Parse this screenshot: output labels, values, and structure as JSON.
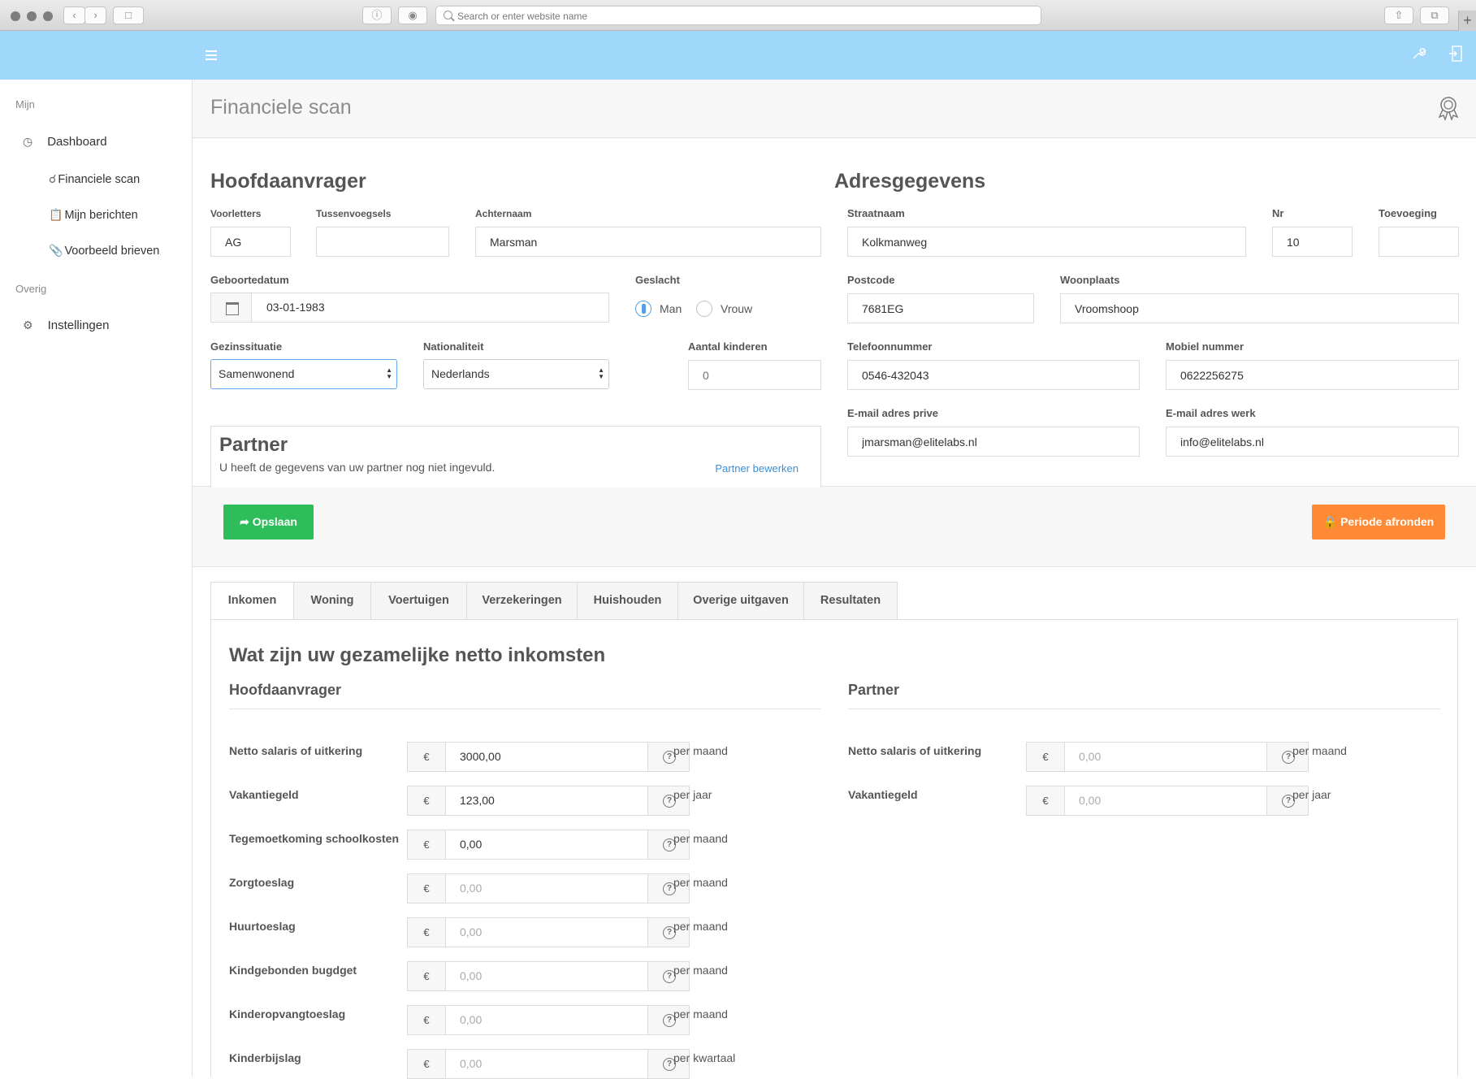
{
  "browser": {
    "url_placeholder": "Search or enter website name",
    "add_tab": "+"
  },
  "sidebar": {
    "section_mijn": "Mijn",
    "dashboard": "Dashboard",
    "financiele_scan": "Financiele scan",
    "mijn_berichten": "Mijn berichten",
    "voorbeeld_brieven": "Voorbeeld brieven",
    "section_overig": "Overig",
    "instellingen": "Instellingen"
  },
  "page": {
    "title": "Financiele scan"
  },
  "hoofdaanvrager": {
    "title": "Hoofdaanvrager",
    "voorletters_label": "Voorletters",
    "voorletters": "AG",
    "tussenvoegsels_label": "Tussenvoegsels",
    "tussenvoegsels": "",
    "achternaam_label": "Achternaam",
    "achternaam": "Marsman",
    "geboortedatum_label": "Geboortedatum",
    "geboortedatum": "03-01-1983",
    "geslacht_label": "Geslacht",
    "geslacht_man": "Man",
    "geslacht_vrouw": "Vrouw",
    "gezinssituatie_label": "Gezinssituatie",
    "gezinssituatie": "Samenwonend",
    "nationaliteit_label": "Nationaliteit",
    "nationaliteit": "Nederlands",
    "kinderen_label": "Aantal kinderen",
    "kinderen_placeholder": "0"
  },
  "partner": {
    "title": "Partner",
    "description": "U heeft de gegevens van uw partner nog niet ingevuld.",
    "link": "Partner bewerken"
  },
  "adres": {
    "title": "Adresgegevens",
    "straatnaam_label": "Straatnaam",
    "straatnaam": "Kolkmanweg",
    "nr_label": "Nr",
    "nr": "10",
    "toevoeging_label": "Toevoeging",
    "toevoeging": "",
    "postcode_label": "Postcode",
    "postcode": "7681EG",
    "woonplaats_label": "Woonplaats",
    "woonplaats": "Vroomshoop",
    "telefoon_label": "Telefoonnummer",
    "telefoon": "0546-432043",
    "mobiel_label": "Mobiel nummer",
    "mobiel": "0622256275",
    "email_prive_label": "E-mail adres prive",
    "email_prive": "jmarsman@elitelabs.nl",
    "email_werk_label": "E-mail adres werk",
    "email_werk": "info@elitelabs.nl"
  },
  "actions": {
    "save": "Opslaan",
    "close_period": "Periode afronden"
  },
  "tabs": [
    "Inkomen",
    "Woning",
    "Voertuigen",
    "Verzekeringen",
    "Huishouden",
    "Overige uitgaven",
    "Resultaten"
  ],
  "inkomen": {
    "question": "Wat zijn uw gezamelijke netto inkomsten",
    "currency": "€",
    "main_title": "Hoofdaanvrager",
    "partner_title": "Partner",
    "main_rows": [
      {
        "label": "Netto salaris of uitkering",
        "value": "3000,00",
        "unit": "per maand"
      },
      {
        "label": "Vakantiegeld",
        "value": "123,00",
        "unit": "per jaar"
      },
      {
        "label": "Tegemoetkoming schoolkosten",
        "value": "0,00",
        "unit": "per maand"
      },
      {
        "label": "Zorgtoeslag",
        "placeholder": "0,00",
        "unit": "per maand"
      },
      {
        "label": "Huurtoeslag",
        "placeholder": "0,00",
        "unit": "per maand"
      },
      {
        "label": "Kindgebonden bugdget",
        "placeholder": "0,00",
        "unit": "per maand"
      },
      {
        "label": "Kinderopvangtoeslag",
        "placeholder": "0,00",
        "unit": "per maand"
      },
      {
        "label": "Kinderbijslag",
        "placeholder": "0,00",
        "unit": "per kwartaal"
      }
    ],
    "partner_rows": [
      {
        "label": "Netto salaris of uitkering",
        "placeholder": "0,00",
        "unit": "per maand"
      },
      {
        "label": "Vakantiegeld",
        "placeholder": "0,00",
        "unit": "per jaar"
      }
    ]
  }
}
